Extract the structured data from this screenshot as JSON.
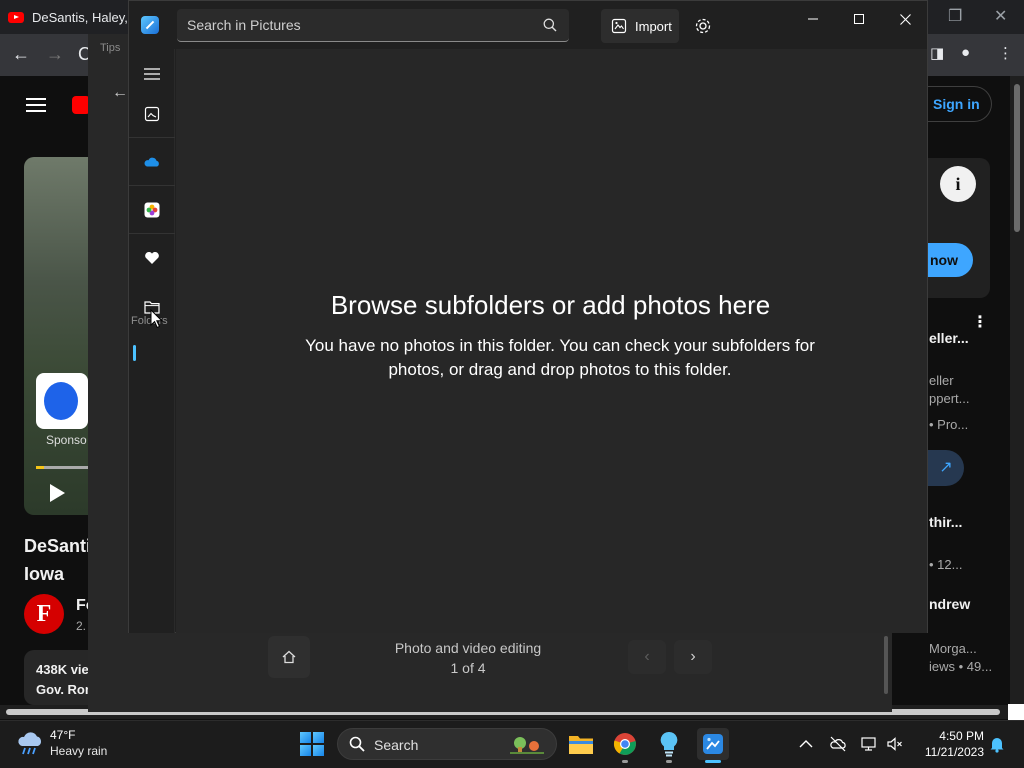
{
  "chrome": {
    "tab_title": "DeSantis, Haley,",
    "youtube_signin": "Sign in",
    "video_title_line1": "DeSanti",
    "video_title_line2": "Iowa",
    "channel_logo_letter": "F",
    "channel_name": "Fo",
    "channel_subs": "2.",
    "sponsor_label": "Sponso",
    "views": "438K vie",
    "desc_snippet": "Gov. Ron",
    "info_symbol": "i",
    "ad_button": "now",
    "recommendations": [
      {
        "text": "eller...",
        "bold": true
      },
      {
        "text": "eller",
        "bold": false
      },
      {
        "text": "ppert...",
        "bold": false
      },
      {
        "text": "• Pro...",
        "bold": false
      },
      {
        "text": "thir...",
        "bold": true
      },
      {
        "text": "• 12...",
        "bold": false
      },
      {
        "text": "ndrew",
        "bold": true
      },
      {
        "text": "Morga...",
        "bold": false
      },
      {
        "text": "iews • 49...",
        "bold": false
      }
    ]
  },
  "tips_window": {
    "label": "Tips",
    "footer_text": "Photo and video editing",
    "pager": "1 of 4"
  },
  "photos": {
    "search_placeholder": "Search in Pictures",
    "import_label": "Import",
    "sidebar_tooltip": "Folders",
    "empty_title": "Browse subfolders or add photos here",
    "empty_body": "You have no photos in this folder. You can check your subfolders for photos, or drag and drop photos to this folder.",
    "accent_color": "#4cc2ff"
  },
  "taskbar": {
    "temperature": "47°F",
    "weather": "Heavy rain",
    "search_label": "Search",
    "time": "4:50 PM",
    "date": "11/21/2023"
  }
}
